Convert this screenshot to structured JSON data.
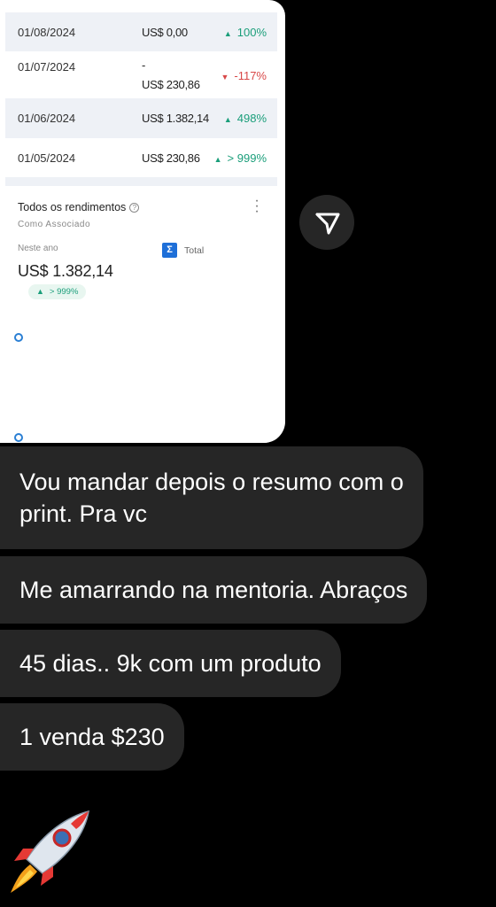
{
  "history": {
    "rows": [
      {
        "date": "01/08/2024",
        "value": "US$ 0,00",
        "change": "100%",
        "dir": "up"
      },
      {
        "date": "01/07/2024",
        "dash": "-",
        "value": "US$ 230,86",
        "change": "-117%",
        "dir": "down"
      },
      {
        "date": "01/06/2024",
        "value": "US$ 1.382,14",
        "change": "498%",
        "dir": "up"
      },
      {
        "date": "01/05/2024",
        "value": "US$ 230,86",
        "change": "> 999%",
        "dir": "up"
      }
    ]
  },
  "earnings": {
    "title": "Todos os rendimentos",
    "subtitle": "Como Associado",
    "period_label": "Neste ano",
    "sum_icon": "Σ",
    "total_label": "Total",
    "amount": "US$ 1.382,14",
    "change": "> 999%"
  },
  "messages": [
    {
      "text": "Vou mandar depois o resumo com o"
    },
    {
      "text": "print. Pra vc"
    },
    {
      "text": "Me amarrando na mentoria. Abraços"
    },
    {
      "text": "45 dias.. 9k com um produto"
    },
    {
      "text": "1 venda $230"
    }
  ],
  "icons": {
    "send": "send-icon",
    "rocket": "rocket-icon"
  },
  "colors": {
    "up": "#1a9e7a",
    "down": "#d84848",
    "bubble": "#262626",
    "accent": "#1e6fd8"
  }
}
